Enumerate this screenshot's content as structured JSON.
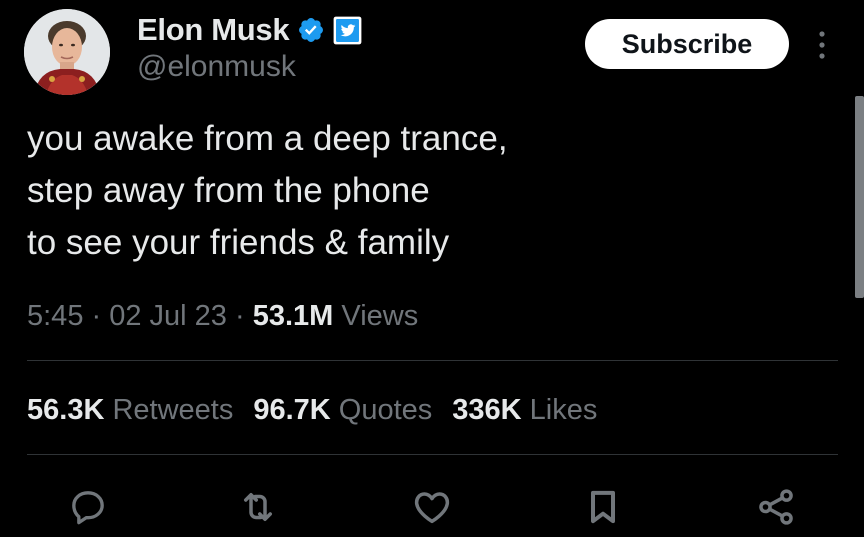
{
  "author": {
    "display_name": "Elon Musk",
    "handle": "@elonmusk",
    "verified": true,
    "affiliate_badge": "twitter-bird-badge"
  },
  "header": {
    "subscribe_label": "Subscribe",
    "more_icon": "more-vertical-icon"
  },
  "tweet": {
    "lines": [
      "you awake from a deep trance,",
      "step away from the phone",
      "to see your friends & family"
    ]
  },
  "meta": {
    "time": "5:45",
    "sep1": " · ",
    "date": "02 Jul 23",
    "sep2": " · ",
    "views_count": "53.1M",
    "views_label": " Views"
  },
  "stats": {
    "retweets_count": "56.3K",
    "retweets_label": " Retweets",
    "quotes_count": "96.7K",
    "quotes_label": " Quotes",
    "likes_count": "336K",
    "likes_label": " Likes"
  },
  "actions": [
    "reply-icon",
    "retweet-icon",
    "like-icon",
    "bookmark-icon",
    "share-icon"
  ],
  "colors": {
    "background": "#000000",
    "text_primary": "#e7e9ea",
    "text_secondary": "#71767b",
    "verified_blue": "#1d9bf0",
    "divider": "#2f3336"
  }
}
